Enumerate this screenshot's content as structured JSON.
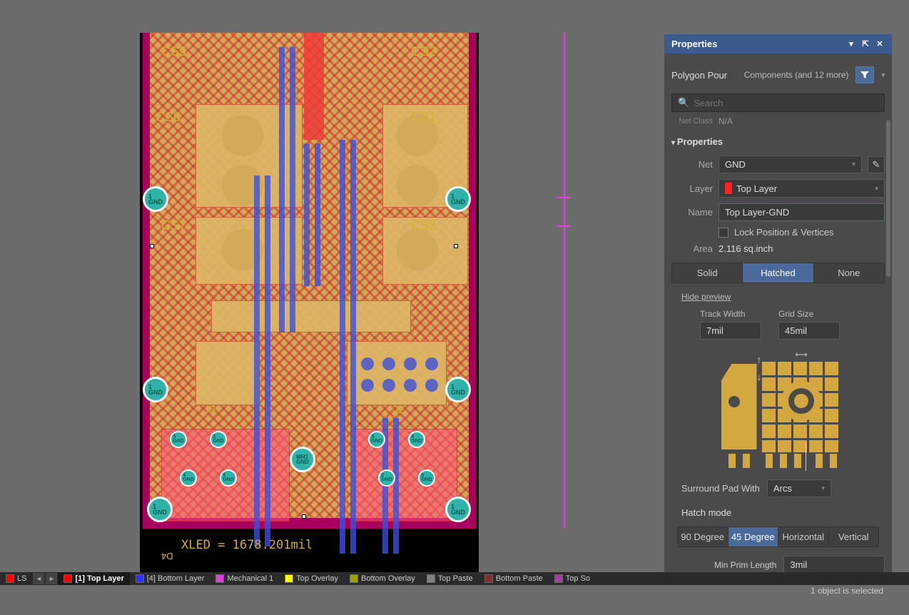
{
  "toolbar": {
    "icons": [
      "filter",
      "selection",
      "move",
      "rect",
      "align",
      "grid",
      "snap",
      "wave",
      "key",
      "paint",
      "measure",
      "dimension",
      "text",
      "line"
    ]
  },
  "canvas": {
    "labels": {
      "cs5": "CS5",
      "cs2": "CS2",
      "cs6": "CS6",
      "cs1": "CS1",
      "cs7": "CS7",
      "cs3": "CS3",
      "j3": "J3",
      "j2": "J2",
      "mh1": "MH1",
      "gnd": "GND",
      "d4": "D4"
    },
    "via_label": "1\nGND",
    "via_small": [
      "3\nGND",
      "2\nGND",
      "3\nGND",
      "4\nGND",
      "4\nGND",
      "5\nGND",
      "2\nGND",
      "5\nGND"
    ],
    "dimension_text": "XLED = 1678.201mil"
  },
  "properties": {
    "panel_title": "Properties",
    "object_type": "Polygon Pour",
    "filter_text": "Components (and 12 more)",
    "search_placeholder": "Search",
    "net_class_label": "Net Class",
    "net_class_value": "N/A",
    "section_title": "Properties",
    "net_label": "Net",
    "net_value": "GND",
    "layer_label": "Layer",
    "layer_value": "Top Layer",
    "name_label": "Name",
    "name_value": "Top Layer-GND",
    "lock_label": "Lock Position & Vertices",
    "area_label": "Area",
    "area_value": "2.116 sq.inch",
    "fill_modes": {
      "solid": "Solid",
      "hatched": "Hatched",
      "none": "None"
    },
    "hide_preview": "Hide preview",
    "track_width_label": "Track Width",
    "track_width_value": "7mil",
    "grid_size_label": "Grid Size",
    "grid_size_value": "45mil",
    "surround_label": "Surround Pad With",
    "surround_value": "Arcs",
    "hatch_section": "Hatch mode",
    "hatch_modes": {
      "d90": "90 Degree",
      "d45": "45 Degree",
      "hor": "Horizontal",
      "ver": "Vertical"
    },
    "min_prim_label": "Min Prim Length",
    "min_prim_value": "3mil"
  },
  "layers": {
    "tabs": [
      {
        "name": "LS",
        "color": "#ff0000"
      },
      {
        "name": "[1] Top Layer",
        "color": "#ff0000",
        "active": true
      },
      {
        "name": "[4] Bottom Layer",
        "color": "#3030ff"
      },
      {
        "name": "Mechanical 1",
        "color": "#e040e0"
      },
      {
        "name": "Top Overlay",
        "color": "#ffff00"
      },
      {
        "name": "Bottom Overlay",
        "color": "#a0a000"
      },
      {
        "name": "Top Paste",
        "color": "#808080"
      },
      {
        "name": "Bottom Paste",
        "color": "#803030"
      },
      {
        "name": "Top So",
        "color": "#a040a0"
      }
    ]
  },
  "status": "1 object is selected"
}
